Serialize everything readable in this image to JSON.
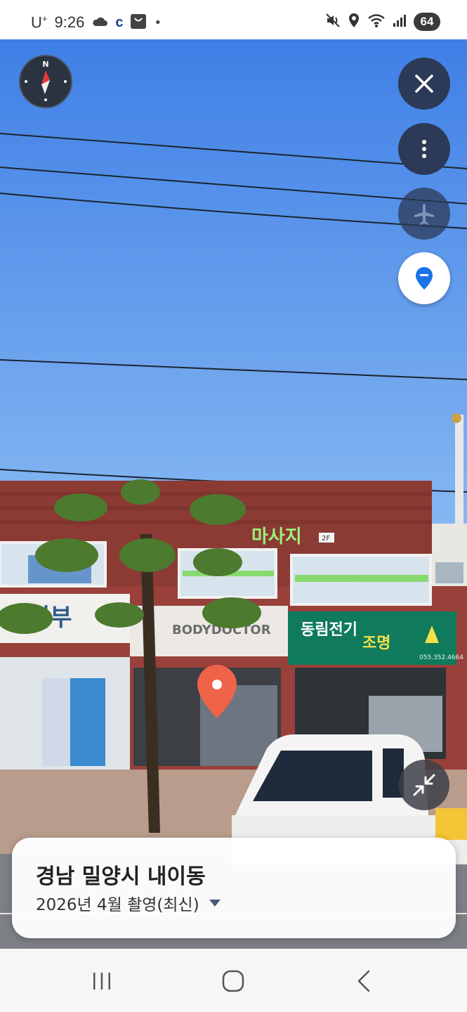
{
  "status_bar": {
    "carrier": "U",
    "carrier_sup": "+",
    "time": "9:26",
    "notif_c": "c",
    "dot": "•",
    "battery": "64"
  },
  "controls": {
    "compass_letter": "N",
    "close_icon": "close-icon",
    "more_icon": "more-vertical-icon",
    "plane_icon": "airplane-icon",
    "pin_icon": "location-pin-icon",
    "collapse_icon": "collapse-icon"
  },
  "scene": {
    "sign_massage": "마사지",
    "sign_2f": "2F",
    "sign_skin": "피부",
    "sign_bodydoctor": "BODYDOCTOR",
    "sign_electric_a": "동림전기",
    "sign_electric_b": "조명",
    "sign_phone": "055.352.4664"
  },
  "info_card": {
    "place_name": "경남 밀양시 내이동",
    "capture_date": "2026년 4월 촬영(최신)"
  },
  "colors": {
    "sky_top": "#3f7fe6",
    "sky_bottom": "#86b8f2",
    "accent_blue": "#1a73e8",
    "marker_red": "#ef6449",
    "control_dark": "#2c3a57"
  }
}
